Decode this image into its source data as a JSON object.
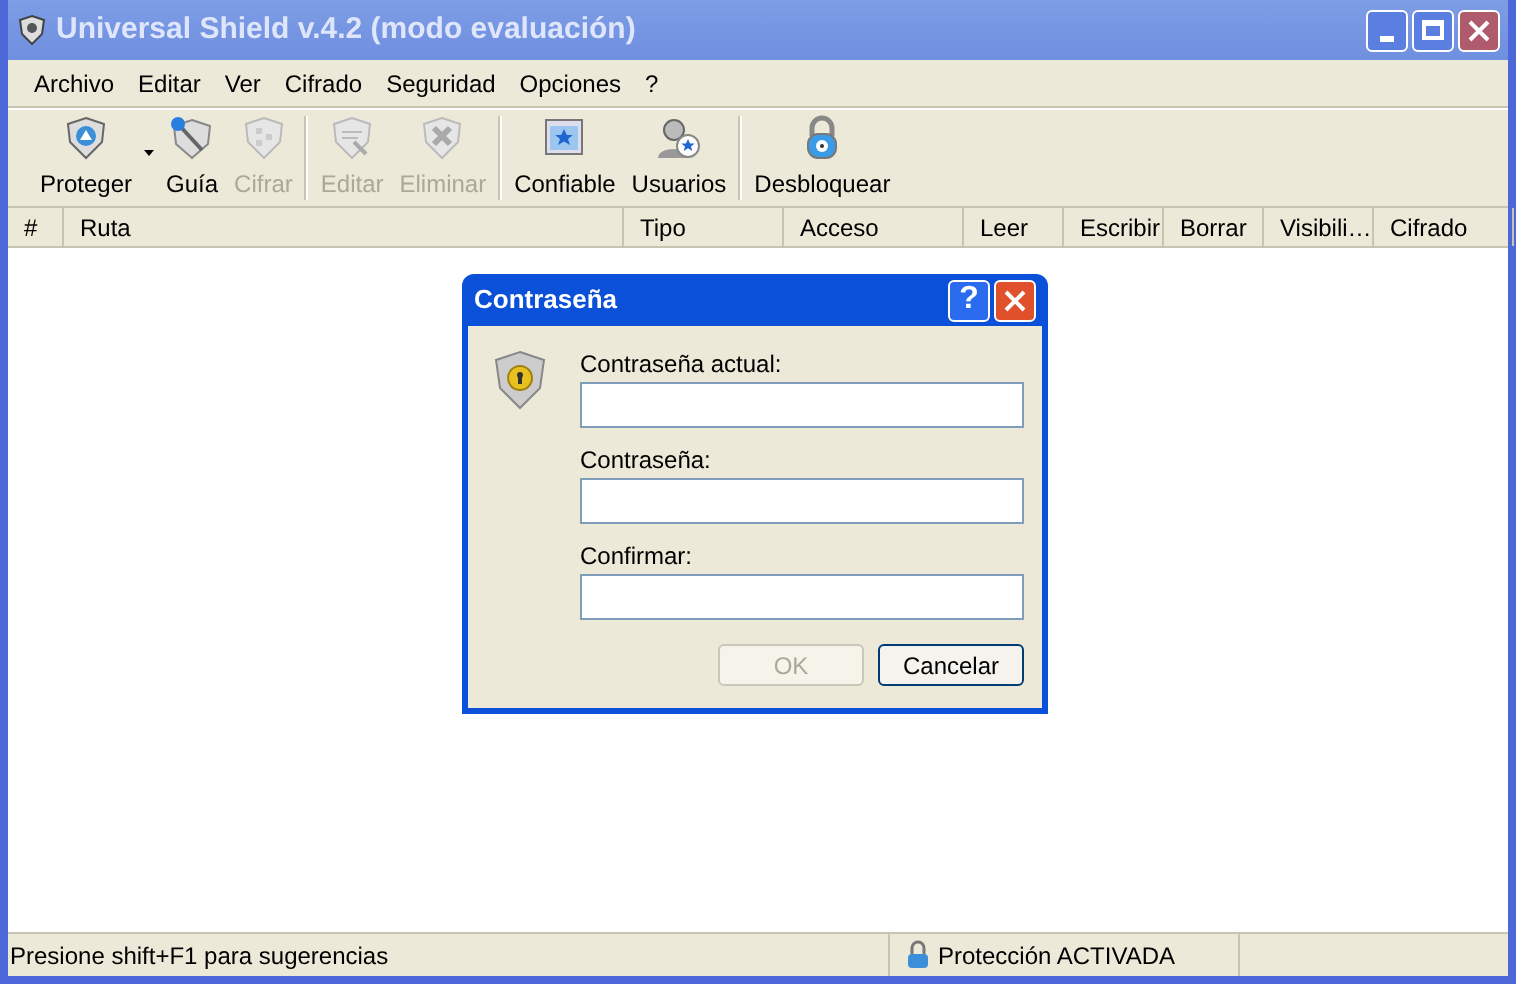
{
  "window": {
    "title": "Universal Shield v.4.2 (modo evaluación)"
  },
  "menu": [
    "Archivo",
    "Editar",
    "Ver",
    "Cifrado",
    "Seguridad",
    "Opciones",
    "?"
  ],
  "toolbar": [
    {
      "label": "Proteger",
      "disabled": false,
      "dropdown": true,
      "separator_before": false
    },
    {
      "label": "Guía",
      "disabled": false,
      "dropdown": false,
      "separator_before": false
    },
    {
      "label": "Cifrar",
      "disabled": true,
      "dropdown": false,
      "separator_before": false
    },
    {
      "label": "Editar",
      "disabled": true,
      "dropdown": false,
      "separator_before": true
    },
    {
      "label": "Eliminar",
      "disabled": true,
      "dropdown": false,
      "separator_before": false
    },
    {
      "label": "Confiable",
      "disabled": false,
      "dropdown": false,
      "separator_before": true
    },
    {
      "label": "Usuarios",
      "disabled": false,
      "dropdown": false,
      "separator_before": false
    },
    {
      "label": "Desbloquear",
      "disabled": false,
      "dropdown": false,
      "separator_before": true
    }
  ],
  "table": {
    "columns": [
      "#",
      "Ruta",
      "Tipo",
      "Acceso",
      "Leer",
      "Escribir",
      "Borrar",
      "Visibili…",
      "Cifrado"
    ]
  },
  "dialog": {
    "title": "Contraseña",
    "help_glyph": "?",
    "fields": [
      {
        "label": "Contraseña actual:"
      },
      {
        "label": "Contraseña:"
      },
      {
        "label": "Confirmar:"
      }
    ],
    "buttons": [
      {
        "label": "OK",
        "disabled": true
      },
      {
        "label": "Cancelar",
        "disabled": false
      }
    ]
  },
  "status_bar": {
    "hint": "Presione shift+F1 para sugerencias",
    "protection": "Protección ACTIVADA"
  }
}
